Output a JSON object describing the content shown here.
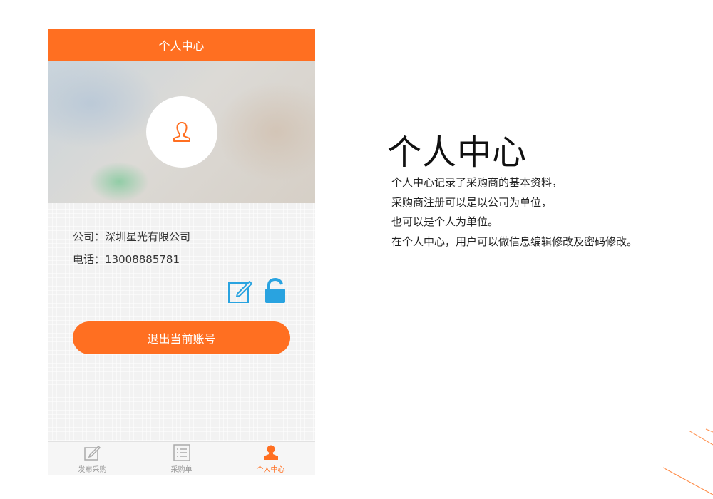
{
  "header": {
    "title": "个人中心"
  },
  "profile": {
    "company_label": "公司：",
    "company_value": "深圳星光有限公司",
    "phone_label": "电话：",
    "phone_value": "13008885781"
  },
  "actions": {
    "logout_label": "退出当前账号"
  },
  "tabs": [
    {
      "label": "发布采购",
      "icon": "edit-icon",
      "active": false
    },
    {
      "label": "采购单",
      "icon": "list-icon",
      "active": false
    },
    {
      "label": "个人中心",
      "icon": "person-icon",
      "active": true
    }
  ],
  "side": {
    "title": "个人中心",
    "lines": [
      "个人中心记录了采购商的基本资料，",
      "采购商注册可以是以公司为单位，",
      "也可以是个人为单位。",
      "在个人中心，用户可以做信息编辑修改及密码修改。"
    ]
  },
  "colors": {
    "accent": "#ff6f21",
    "icon_blue": "#29a3e0"
  }
}
